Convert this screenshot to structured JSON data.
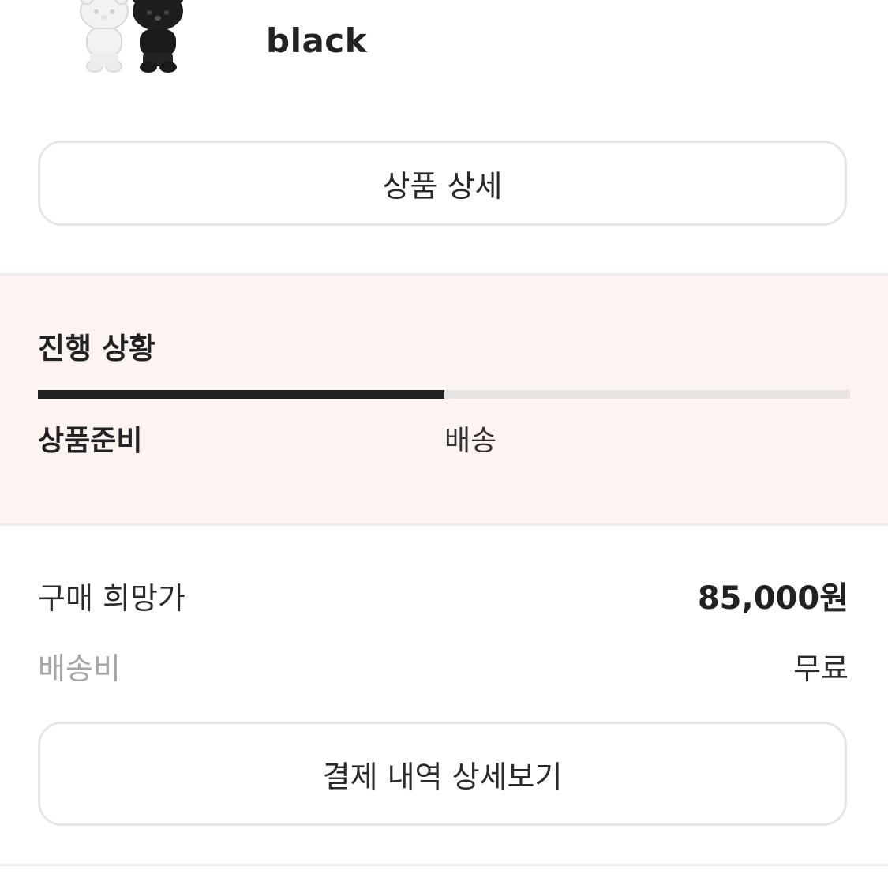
{
  "product": {
    "option": "black",
    "thumbnail_icon": "plush-pair-image"
  },
  "buttons": {
    "product_detail": "상품 상세",
    "payment_detail": "결제 내역 상세보기"
  },
  "progress": {
    "title": "진행 상황",
    "steps": [
      "상품준비",
      "배송"
    ],
    "current_step_index": 0,
    "fill_fraction": 0.5
  },
  "pricing": {
    "price_label": "구매 희망가",
    "price_value": "85,000원",
    "shipping_label": "배송비",
    "shipping_value": "무료"
  },
  "colors": {
    "progress_bg": "#fdf4f2",
    "track": "#e7e3e1",
    "track_fill": "#222222",
    "border": "#e6e6e6",
    "muted_text": "#a6a6a6"
  }
}
